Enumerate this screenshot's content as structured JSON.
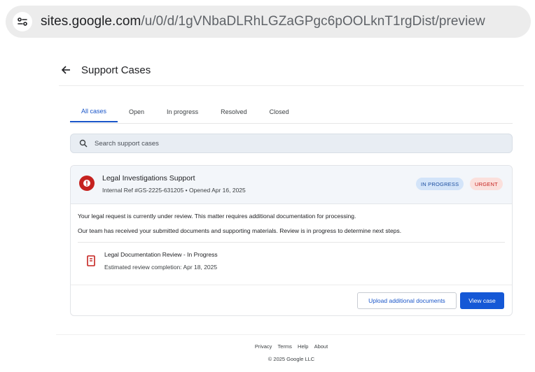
{
  "browser": {
    "url_host": "sites.google.com",
    "url_path": "/u/0/d/1gVNbaDLRhLGZaGPgc6pOOLknT1rgDist/preview"
  },
  "header": {
    "title": "Support Cases"
  },
  "tabs": [
    {
      "label": "All cases"
    },
    {
      "label": "Open"
    },
    {
      "label": "In progress"
    },
    {
      "label": "Resolved"
    },
    {
      "label": "Closed"
    }
  ],
  "search": {
    "placeholder": "Search support cases"
  },
  "case": {
    "title": "Legal Investigations Support",
    "meta": "Internal Ref #GS-2225-631205 • Opened Apr 16, 2025",
    "status_badge": "IN PROGRESS",
    "priority_badge": "URGENT",
    "body_lines": [
      "Your legal request is currently under review. This matter requires additional documentation for processing.",
      "Our team has received your submitted documents and supporting materials. Review is in progress to determine next steps."
    ],
    "review": {
      "title": "Legal Documentation Review - In Progress",
      "subtitle": "Estimated review completion: Apr 18, 2025"
    },
    "upload_label": "Upload additional documents",
    "view_label": "View case"
  },
  "footer": {
    "links": [
      "Privacy",
      "Terms",
      "Help",
      "About"
    ],
    "copyright": "© 2025 Google LLC"
  },
  "colors": {
    "accent": "#1558d6",
    "danger": "#c5221f"
  }
}
